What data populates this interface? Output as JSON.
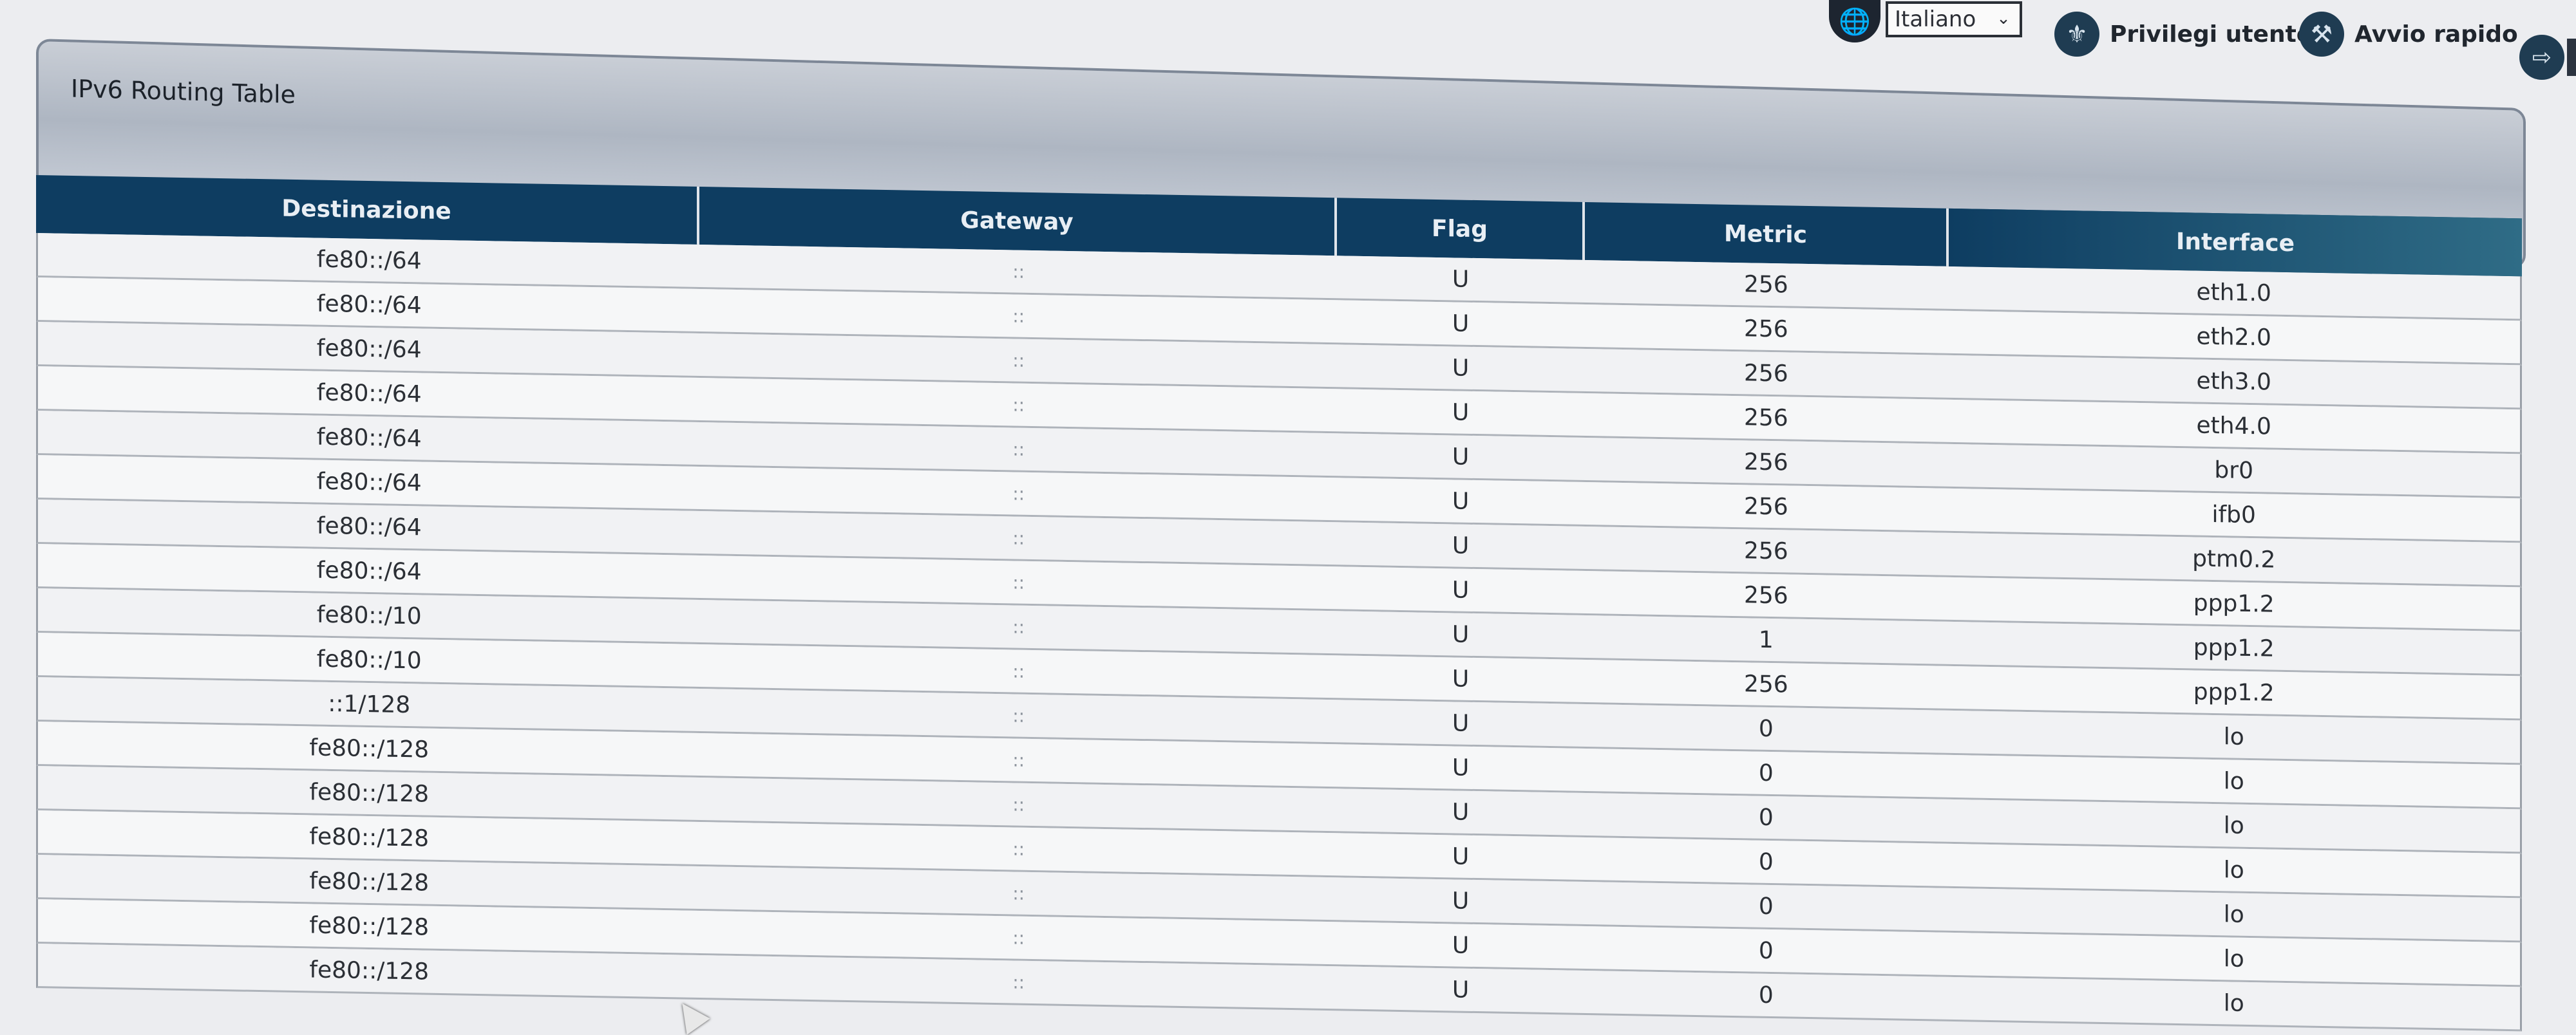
{
  "header": {
    "language_selected": "Italiano",
    "privileges_label": "Privilegi utente",
    "quickstart_label": "Avvio rapido"
  },
  "page": {
    "title": "IPv6 Routing Table"
  },
  "table": {
    "columns": [
      "Destinazione",
      "Gateway",
      "Flag",
      "Metric",
      "Interface"
    ],
    "rows": [
      [
        "fe80::/64",
        "::",
        "U",
        "256",
        "eth1.0"
      ],
      [
        "fe80::/64",
        "::",
        "U",
        "256",
        "eth2.0"
      ],
      [
        "fe80::/64",
        "::",
        "U",
        "256",
        "eth3.0"
      ],
      [
        "fe80::/64",
        "::",
        "U",
        "256",
        "eth4.0"
      ],
      [
        "fe80::/64",
        "::",
        "U",
        "256",
        "br0"
      ],
      [
        "fe80::/64",
        "::",
        "U",
        "256",
        "ifb0"
      ],
      [
        "fe80::/64",
        "::",
        "U",
        "256",
        "ptm0.2"
      ],
      [
        "fe80::/64",
        "::",
        "U",
        "256",
        "ppp1.2"
      ],
      [
        "fe80::/10",
        "::",
        "U",
        "1",
        "ppp1.2"
      ],
      [
        "fe80::/10",
        "::",
        "U",
        "256",
        "ppp1.2"
      ],
      [
        "::1/128",
        "::",
        "U",
        "0",
        "lo"
      ],
      [
        "fe80::/128",
        "::",
        "U",
        "0",
        "lo"
      ],
      [
        "fe80::/128",
        "::",
        "U",
        "0",
        "lo"
      ],
      [
        "fe80::/128",
        "::",
        "U",
        "0",
        "lo"
      ],
      [
        "fe80::/128",
        "::",
        "U",
        "0",
        "lo"
      ],
      [
        "fe80::/128",
        "::",
        "U",
        "0",
        "lo"
      ],
      [
        "fe80::/128",
        "::",
        "U",
        "0",
        "lo"
      ]
    ]
  },
  "icons": {
    "language": "globe-icon",
    "privileges": "user-privileges-icon",
    "quickstart": "wrench-icon",
    "logout": "logout-icon"
  }
}
